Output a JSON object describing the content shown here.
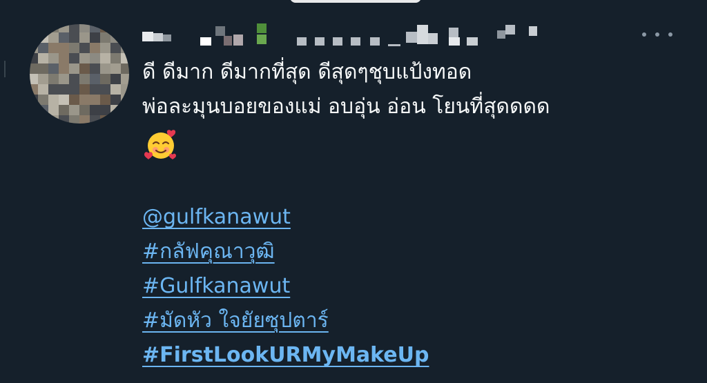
{
  "theme": {
    "background": "#15202b",
    "text": "#f7f9f9",
    "link": "#6cb6f2",
    "muted": "#8b98a5"
  },
  "tweet": {
    "author_hidden": true,
    "text_lines": [
      "ดี ดีมาก ดีมากที่สุด ดีสุดๆชุบแป้งทอด",
      "พ่อละมุนบอยของแม่ อบอุ่น อ่อน โยนที่สุดดดด"
    ],
    "emoji": "smiling-face-with-hearts-icon",
    "mention": "@gulfkanawut",
    "hashtags": [
      "#กลัฟคุณาวุฒิ",
      "#Gulfkanawut",
      "#มัดหัว ใจยัยซุปตาร์",
      "#FirstLookURMyMakeUp"
    ]
  },
  "actions": {
    "more_icon": "more-horizontal-icon"
  }
}
